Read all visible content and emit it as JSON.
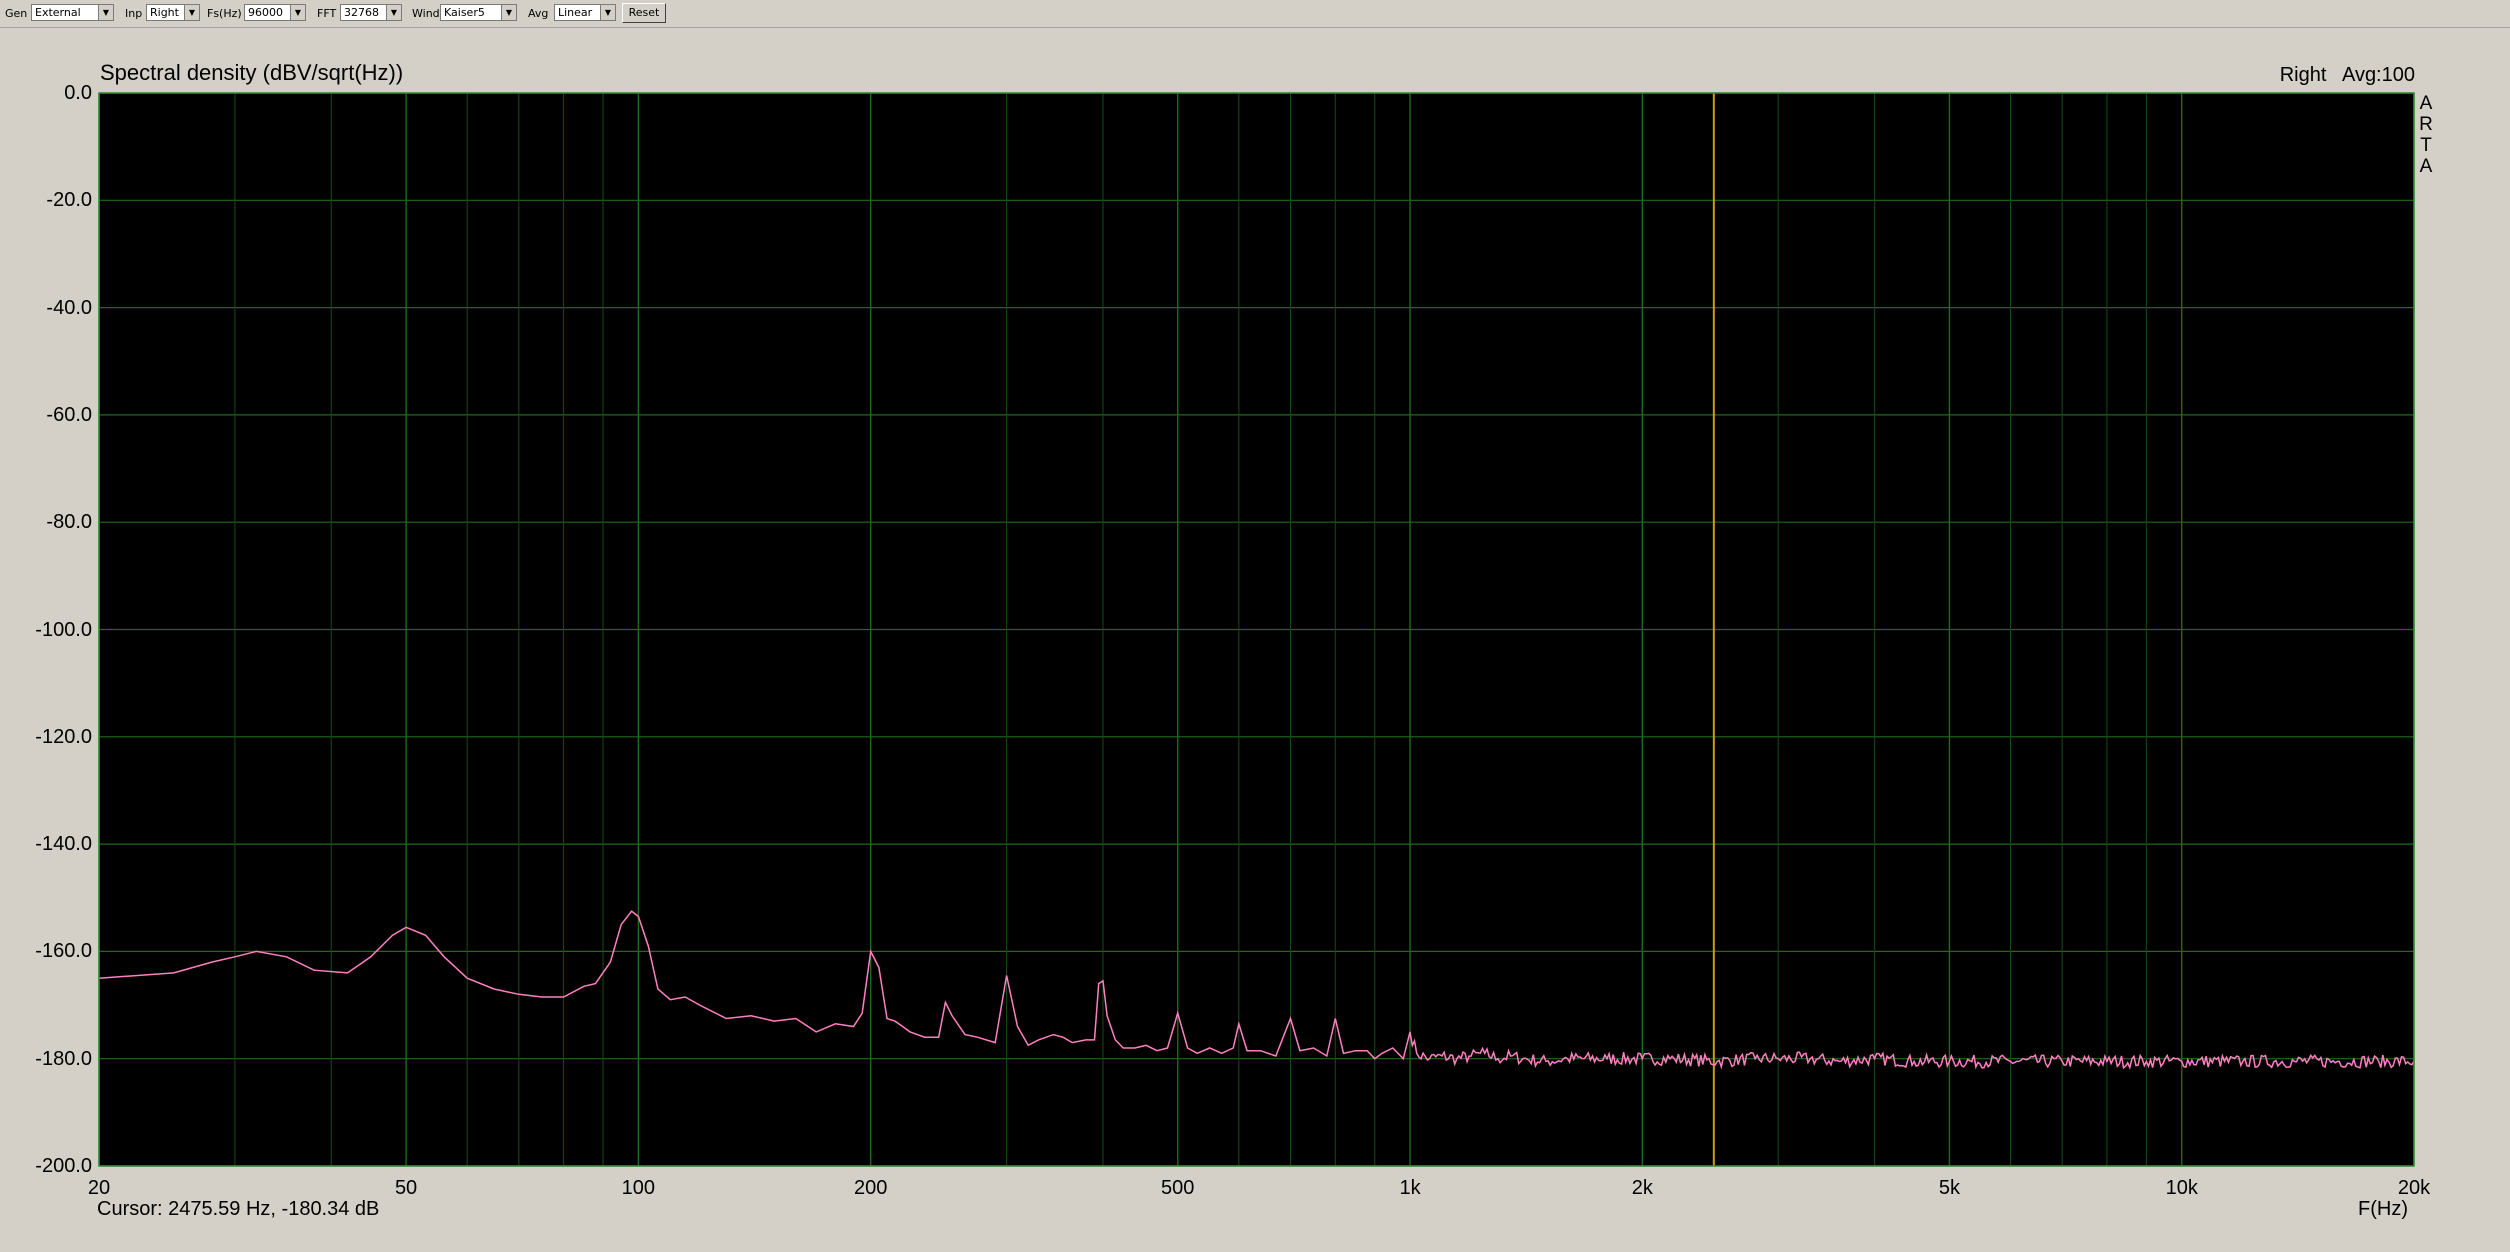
{
  "toolbar": {
    "gen_label": "Gen",
    "gen_value": "External",
    "inp_label": "Inp",
    "inp_value": "Right",
    "fs_label": "Fs(Hz)",
    "fs_value": "96000",
    "fft_label": "FFT",
    "fft_value": "32768",
    "wind_label": "Wind",
    "wind_value": "Kaiser5",
    "avg_label": "Avg",
    "avg_value": "Linear",
    "reset_label": "Reset"
  },
  "status": {
    "right_text": "Right   Avg:100"
  },
  "arta_letters": [
    "A",
    "R",
    "T",
    "A"
  ],
  "cursor_readout": "Cursor: 2475.59 Hz, -180.34 dB",
  "colors": {
    "background": "#000000",
    "grid": "#1e6b1e",
    "trace": "#ff80c0",
    "cursor": "#c8a000",
    "frame": "#3a8a3a"
  },
  "chart_data": {
    "type": "line",
    "title": "Spectral density (dBV/sqrt(Hz))",
    "xlabel": "F(Hz)",
    "ylabel": "",
    "x_scale": "log",
    "xlim": [
      20,
      20000
    ],
    "ylim": [
      -200,
      0
    ],
    "grid": true,
    "yticks": [
      0,
      -20,
      -40,
      -60,
      -80,
      -100,
      -120,
      -140,
      -160,
      -180,
      -200
    ],
    "ytick_labels": [
      "0.0",
      "-20.0",
      "-40.0",
      "-60.0",
      "-80.0",
      "-100.0",
      "-120.0",
      "-140.0",
      "-160.0",
      "-180.0",
      "-200.0"
    ],
    "xticks": [
      20,
      50,
      100,
      200,
      500,
      1000,
      2000,
      5000,
      10000,
      20000
    ],
    "xtick_labels": [
      "20",
      "50",
      "100",
      "200",
      "500",
      "1k",
      "2k",
      "5k",
      "10k",
      "20k"
    ],
    "cursor_x": 2475.59,
    "series": [
      {
        "x": [
          20,
          25,
          28,
          30,
          32,
          35,
          38,
          42,
          45,
          48,
          50,
          53,
          56,
          60,
          65,
          70,
          75,
          80,
          85,
          88,
          92,
          95,
          98,
          100,
          103,
          106,
          110,
          115,
          120,
          130,
          140,
          150,
          160,
          170,
          180,
          190,
          195,
          200,
          205,
          210,
          215,
          220,
          225,
          235,
          245,
          250,
          255,
          265,
          275,
          290,
          300,
          310,
          320,
          330,
          345,
          355,
          365,
          380,
          390,
          395,
          400,
          405,
          415,
          425,
          440,
          455,
          470,
          485,
          500,
          515,
          530,
          550,
          570,
          590,
          600,
          615,
          640,
          670,
          700,
          720,
          750,
          780,
          800,
          820,
          850,
          880,
          900,
          920,
          950,
          980,
          1000,
          1020,
          1060,
          1100,
          1150,
          1200,
          1250,
          1300,
          1350,
          1400,
          1500,
          1600,
          1800,
          2000,
          2200,
          2500,
          2800,
          3000,
          3300,
          3600,
          4000,
          4500,
          5000,
          6000,
          7000,
          8000,
          9000,
          10000,
          12000,
          14000,
          16000,
          18000,
          20000
        ],
        "y": [
          -165,
          -164,
          -162,
          -161,
          -160,
          -161,
          -163.5,
          -164,
          -161,
          -157,
          -155.5,
          -157,
          -161,
          -165,
          -167,
          -168,
          -168.5,
          -168.5,
          -166.5,
          -166,
          -162,
          -155,
          -152.5,
          -153.5,
          -159,
          -167,
          -169,
          -168.5,
          -170,
          -172.5,
          -172,
          -173,
          -172.5,
          -175,
          -173.5,
          -174,
          -171.5,
          -160,
          -163,
          -172.5,
          -173,
          -174,
          -175,
          -176,
          -176,
          -169.5,
          -172,
          -175.5,
          -176,
          -177,
          -164.5,
          -174,
          -177.5,
          -176.5,
          -175.5,
          -176,
          -177,
          -176.5,
          -176.5,
          -166,
          -165.5,
          -172,
          -176.5,
          -178,
          -178,
          -177.5,
          -178.5,
          -178,
          -171.5,
          -178,
          -179,
          -178,
          -179,
          -178,
          -173.5,
          -178.5,
          -178.5,
          -179.5,
          -172.5,
          -178.5,
          -178,
          -179.5,
          -172.5,
          -179,
          -178.5,
          -178.5,
          -180,
          -179,
          -178,
          -180,
          -175,
          -179,
          -180,
          -179.5,
          -180,
          -179.5,
          -179,
          -180,
          -179.5,
          -180,
          -180.5,
          -180,
          -180,
          -180,
          -180,
          -180.5,
          -180,
          -180,
          -180,
          -180.5,
          -180,
          -180.5,
          -180.5,
          -180.5,
          -180.5,
          -180.5,
          -180.5,
          -180.5,
          -180.5,
          -180.5,
          -180.5,
          -180.5,
          -180.5
        ]
      }
    ]
  }
}
